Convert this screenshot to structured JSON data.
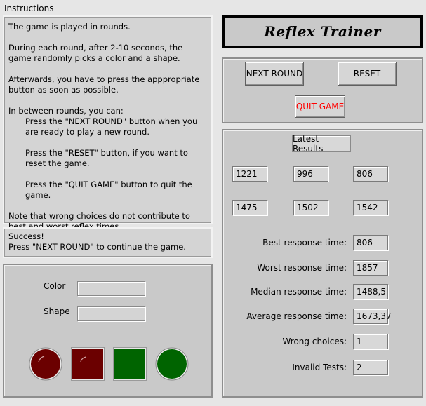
{
  "instructions": {
    "label": "Instructions",
    "p1": "The game is played in rounds.",
    "p2": "During each round, after 2-10 seconds, the game randomly picks a color and a shape.",
    "p3": "Afterwards, you have to press the apppropriate button as soon as possible.",
    "p4": "In between rounds, you can:",
    "p4a": "Press the \"NEXT ROUND\" button when you are ready to play a new round.",
    "p4b": "Press the \"RESET\" button, if you want to reset the game.",
    "p4c": "Press the \"QUIT GAME\" button to quit the game.",
    "p5": "Note that wrong choices do not contribute to best and worst reflex times."
  },
  "status": {
    "line1": "Success!",
    "line2": "Press \"NEXT ROUND\" to continue the game."
  },
  "game": {
    "color_label": "Color",
    "color_value": "",
    "shape_label": "Shape",
    "shape_value": "",
    "buttons": [
      {
        "name": "red-circle",
        "color": "#6b0000",
        "shape": "circle"
      },
      {
        "name": "red-square",
        "color": "#6b0000",
        "shape": "square"
      },
      {
        "name": "green-square",
        "color": "#006400",
        "shape": "square"
      },
      {
        "name": "green-circle",
        "color": "#006400",
        "shape": "circle"
      }
    ]
  },
  "header": {
    "title": "Reflex Trainer"
  },
  "controls": {
    "next_round": "NEXT ROUND",
    "reset": "RESET",
    "quit_game": "QUIT GAME",
    "quit_color": "#ff0000"
  },
  "results": {
    "title": "Latest Results",
    "latest": [
      "1221",
      "996",
      "806",
      "1475",
      "1502",
      "1542"
    ],
    "stats": [
      {
        "label": "Best response time:",
        "value": "806"
      },
      {
        "label": "Worst response time:",
        "value": "1857"
      },
      {
        "label": "Median response time:",
        "value": "1488,5"
      },
      {
        "label": "Average response time:",
        "value": "1673,37"
      },
      {
        "label": "Wrong choices:",
        "value": "1"
      },
      {
        "label": "Invalid Tests:",
        "value": "2"
      }
    ]
  }
}
